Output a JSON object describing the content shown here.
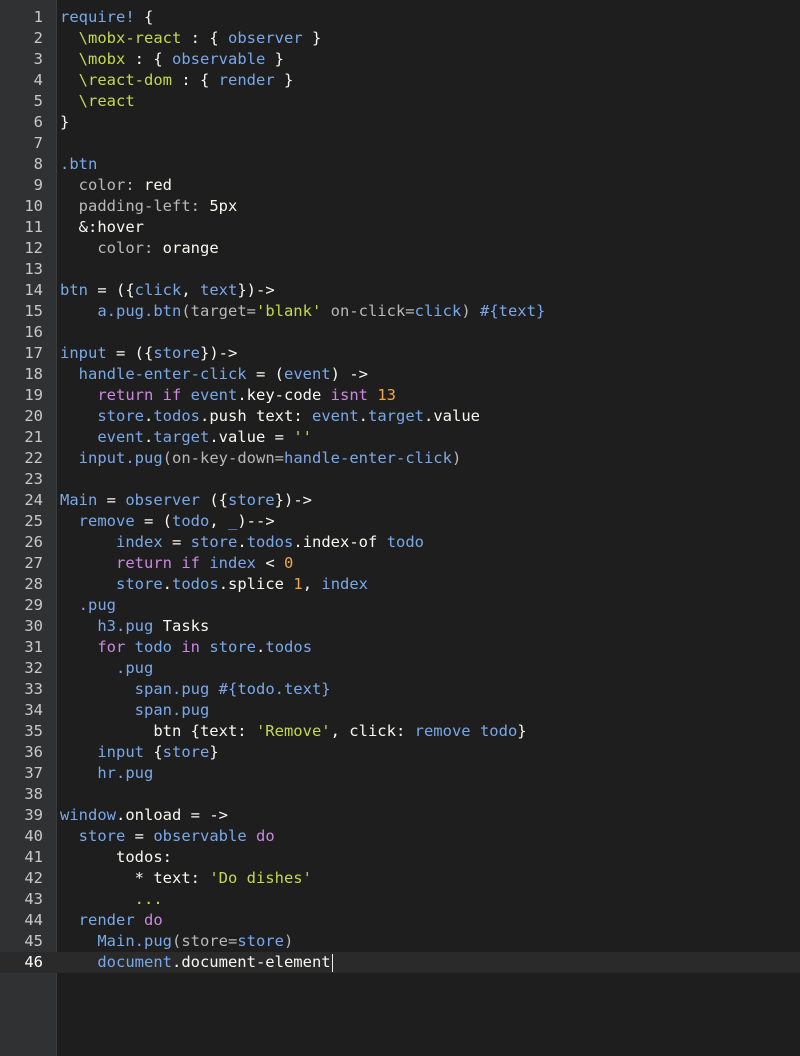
{
  "editor": {
    "colors": {
      "background": "#1e1e1e",
      "gutter": "#2f3133",
      "plain": "#f8f8f2",
      "keyword": "#cc88e0",
      "ident": "#79a8ea",
      "string": "#c5d94a",
      "number": "#f0a64a",
      "attr": "#b8b8b8"
    },
    "active_line": 46,
    "lines": [
      [
        [
          "ident",
          "require!"
        ],
        [
          "plain",
          " {"
        ]
      ],
      [
        [
          "plain",
          "  "
        ],
        [
          "string",
          "\\mobx-react"
        ],
        [
          "plain",
          " : { "
        ],
        [
          "ident",
          "observer"
        ],
        [
          "plain",
          " }"
        ]
      ],
      [
        [
          "plain",
          "  "
        ],
        [
          "string",
          "\\mobx"
        ],
        [
          "plain",
          " : { "
        ],
        [
          "ident",
          "observable"
        ],
        [
          "plain",
          " }"
        ]
      ],
      [
        [
          "plain",
          "  "
        ],
        [
          "string",
          "\\react-dom"
        ],
        [
          "plain",
          " : { "
        ],
        [
          "ident",
          "render"
        ],
        [
          "plain",
          " }"
        ]
      ],
      [
        [
          "plain",
          "  "
        ],
        [
          "string",
          "\\react"
        ]
      ],
      [
        [
          "plain",
          "}"
        ]
      ],
      [],
      [
        [
          "ident",
          ".btn"
        ]
      ],
      [
        [
          "plain",
          "  "
        ],
        [
          "attr",
          "color:"
        ],
        [
          "plain",
          " red"
        ]
      ],
      [
        [
          "plain",
          "  "
        ],
        [
          "attr",
          "padding-left:"
        ],
        [
          "plain",
          " 5px"
        ]
      ],
      [
        [
          "plain",
          "  &:hover"
        ]
      ],
      [
        [
          "plain",
          "    "
        ],
        [
          "attr",
          "color:"
        ],
        [
          "plain",
          " orange"
        ]
      ],
      [],
      [
        [
          "ident",
          "btn"
        ],
        [
          "plain",
          " = ({"
        ],
        [
          "ident",
          "click"
        ],
        [
          "plain",
          ", "
        ],
        [
          "ident",
          "text"
        ],
        [
          "plain",
          "})->"
        ]
      ],
      [
        [
          "plain",
          "    "
        ],
        [
          "ident",
          "a.pug.btn"
        ],
        [
          "attr",
          "(target="
        ],
        [
          "string",
          "'blank'"
        ],
        [
          "attr",
          " on-click="
        ],
        [
          "ident",
          "click"
        ],
        [
          "attr",
          ") "
        ],
        [
          "ident",
          "#{text}"
        ]
      ],
      [],
      [
        [
          "ident",
          "input"
        ],
        [
          "plain",
          " = ({"
        ],
        [
          "ident",
          "store"
        ],
        [
          "plain",
          "})->"
        ]
      ],
      [
        [
          "plain",
          "  "
        ],
        [
          "ident",
          "handle-enter-click"
        ],
        [
          "plain",
          " = ("
        ],
        [
          "ident",
          "event"
        ],
        [
          "plain",
          ") ->"
        ]
      ],
      [
        [
          "plain",
          "    "
        ],
        [
          "keyword",
          "return if"
        ],
        [
          "plain",
          " "
        ],
        [
          "ident",
          "event"
        ],
        [
          "plain",
          ".key-code "
        ],
        [
          "keyword",
          "isnt"
        ],
        [
          "plain",
          " "
        ],
        [
          "number",
          "13"
        ]
      ],
      [
        [
          "plain",
          "    "
        ],
        [
          "ident",
          "store"
        ],
        [
          "plain",
          "."
        ],
        [
          "ident",
          "todos"
        ],
        [
          "plain",
          ".push text: "
        ],
        [
          "ident",
          "event"
        ],
        [
          "plain",
          "."
        ],
        [
          "ident",
          "target"
        ],
        [
          "plain",
          ".value"
        ]
      ],
      [
        [
          "plain",
          "    "
        ],
        [
          "ident",
          "event"
        ],
        [
          "plain",
          "."
        ],
        [
          "ident",
          "target"
        ],
        [
          "plain",
          ".value = "
        ],
        [
          "string",
          "''"
        ]
      ],
      [
        [
          "plain",
          "  "
        ],
        [
          "ident",
          "input.pug"
        ],
        [
          "attr",
          "(on-key-down="
        ],
        [
          "ident",
          "handle-enter-click"
        ],
        [
          "attr",
          ")"
        ]
      ],
      [],
      [
        [
          "ident",
          "Main"
        ],
        [
          "plain",
          " = "
        ],
        [
          "ident",
          "observer"
        ],
        [
          "plain",
          " ({"
        ],
        [
          "ident",
          "store"
        ],
        [
          "plain",
          "})->"
        ]
      ],
      [
        [
          "plain",
          "  "
        ],
        [
          "ident",
          "remove"
        ],
        [
          "plain",
          " = ("
        ],
        [
          "ident",
          "todo"
        ],
        [
          "plain",
          ", "
        ],
        [
          "ident",
          "_"
        ],
        [
          "plain",
          ")-->"
        ]
      ],
      [
        [
          "plain",
          "      "
        ],
        [
          "ident",
          "index"
        ],
        [
          "plain",
          " = "
        ],
        [
          "ident",
          "store"
        ],
        [
          "plain",
          "."
        ],
        [
          "ident",
          "todos"
        ],
        [
          "plain",
          ".index-of "
        ],
        [
          "ident",
          "todo"
        ]
      ],
      [
        [
          "plain",
          "      "
        ],
        [
          "keyword",
          "return if"
        ],
        [
          "plain",
          " "
        ],
        [
          "ident",
          "index"
        ],
        [
          "plain",
          " < "
        ],
        [
          "number",
          "0"
        ]
      ],
      [
        [
          "plain",
          "      "
        ],
        [
          "ident",
          "store"
        ],
        [
          "plain",
          "."
        ],
        [
          "ident",
          "todos"
        ],
        [
          "plain",
          ".splice "
        ],
        [
          "number",
          "1"
        ],
        [
          "plain",
          ", "
        ],
        [
          "ident",
          "index"
        ]
      ],
      [
        [
          "plain",
          "  "
        ],
        [
          "ident",
          ".pug"
        ]
      ],
      [
        [
          "plain",
          "    "
        ],
        [
          "ident",
          "h3.pug"
        ],
        [
          "plain",
          " Tasks"
        ]
      ],
      [
        [
          "plain",
          "    "
        ],
        [
          "keyword",
          "for"
        ],
        [
          "plain",
          " "
        ],
        [
          "ident",
          "todo"
        ],
        [
          "plain",
          " "
        ],
        [
          "keyword",
          "in"
        ],
        [
          "plain",
          " "
        ],
        [
          "ident",
          "store"
        ],
        [
          "plain",
          "."
        ],
        [
          "ident",
          "todos"
        ]
      ],
      [
        [
          "plain",
          "      "
        ],
        [
          "ident",
          ".pug"
        ]
      ],
      [
        [
          "plain",
          "        "
        ],
        [
          "ident",
          "span.pug"
        ],
        [
          "plain",
          " "
        ],
        [
          "ident",
          "#{todo.text}"
        ]
      ],
      [
        [
          "plain",
          "        "
        ],
        [
          "ident",
          "span.pug"
        ]
      ],
      [
        [
          "plain",
          "          btn {text: "
        ],
        [
          "string",
          "'Remove'"
        ],
        [
          "plain",
          ", click: "
        ],
        [
          "ident",
          "remove todo"
        ],
        [
          "plain",
          "}"
        ]
      ],
      [
        [
          "plain",
          "    "
        ],
        [
          "ident",
          "input"
        ],
        [
          "plain",
          " {"
        ],
        [
          "ident",
          "store"
        ],
        [
          "plain",
          "}"
        ]
      ],
      [
        [
          "plain",
          "    "
        ],
        [
          "ident",
          "hr.pug"
        ]
      ],
      [],
      [
        [
          "ident",
          "window"
        ],
        [
          "plain",
          ".onload = ->"
        ]
      ],
      [
        [
          "plain",
          "  "
        ],
        [
          "ident",
          "store"
        ],
        [
          "plain",
          " = "
        ],
        [
          "ident",
          "observable"
        ],
        [
          "plain",
          " "
        ],
        [
          "keyword",
          "do"
        ]
      ],
      [
        [
          "plain",
          "      todos:"
        ]
      ],
      [
        [
          "plain",
          "        * text: "
        ],
        [
          "string",
          "'Do dishes'"
        ]
      ],
      [
        [
          "plain",
          "        "
        ],
        [
          "string",
          "..."
        ]
      ],
      [
        [
          "plain",
          "  "
        ],
        [
          "ident",
          "render"
        ],
        [
          "plain",
          " "
        ],
        [
          "keyword",
          "do"
        ]
      ],
      [
        [
          "plain",
          "    "
        ],
        [
          "ident",
          "Main.pug"
        ],
        [
          "attr",
          "(store="
        ],
        [
          "ident",
          "store"
        ],
        [
          "attr",
          ")"
        ]
      ],
      [
        [
          "plain",
          "    "
        ],
        [
          "ident",
          "document"
        ],
        [
          "plain",
          ".document-element"
        ]
      ]
    ]
  }
}
